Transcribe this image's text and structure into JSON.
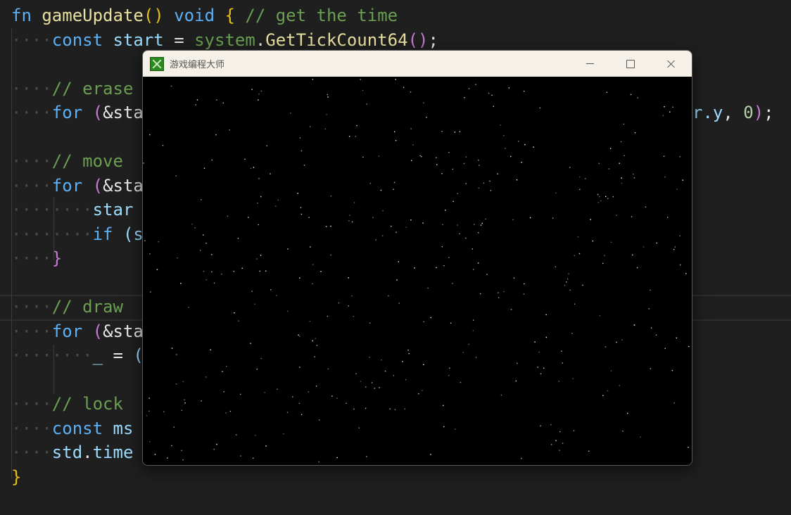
{
  "editor": {
    "colors": {
      "background": "#1f1f1f",
      "keyword": "#5cb0f5",
      "function": "#e8e0a0",
      "comment": "#6a9f52",
      "paren": "#e7c019",
      "paren2": "#c77ad6",
      "ident": "#9cdcfe",
      "number": "#b5cea8",
      "text": "#e6e6e6"
    },
    "lines": [
      {
        "indent": 0,
        "tokens": [
          {
            "t": "fn",
            "c": "keyword"
          },
          {
            "t": " "
          },
          {
            "t": "gameUpdate",
            "c": "function"
          },
          {
            "t": "()",
            "c": "paren"
          },
          {
            "t": " "
          },
          {
            "t": "void",
            "c": "keyword"
          },
          {
            "t": " "
          },
          {
            "t": "{",
            "c": "paren"
          },
          {
            "t": " "
          },
          {
            "t": "// get the time",
            "c": "comment"
          }
        ]
      },
      {
        "indent": 1,
        "tokens": [
          {
            "t": "const",
            "c": "keyword"
          },
          {
            "t": " "
          },
          {
            "t": "start",
            "c": "ident"
          },
          {
            "t": " = "
          },
          {
            "t": "system",
            "c": "comment"
          },
          {
            "t": "."
          },
          {
            "t": "GetTickCount64",
            "c": "function"
          },
          {
            "t": "()",
            "c": "paren2"
          },
          {
            "t": ";"
          }
        ]
      },
      {
        "indent": 0,
        "tokens": []
      },
      {
        "indent": 1,
        "tokens": [
          {
            "t": "// erase",
            "c": "comment"
          }
        ]
      },
      {
        "indent": 1,
        "tokens": [
          {
            "t": "for",
            "c": "keyword"
          },
          {
            "t": " "
          },
          {
            "t": "(",
            "c": "paren2"
          },
          {
            "t": "&sta"
          }
        ]
      },
      {
        "indent": 0,
        "tokens": []
      },
      {
        "indent": 1,
        "tokens": [
          {
            "t": "// move",
            "c": "comment"
          }
        ]
      },
      {
        "indent": 1,
        "tokens": [
          {
            "t": "for",
            "c": "keyword"
          },
          {
            "t": " "
          },
          {
            "t": "(",
            "c": "paren2"
          },
          {
            "t": "&sta"
          }
        ]
      },
      {
        "indent": 2,
        "tokens": [
          {
            "t": "star",
            "c": "ident"
          }
        ]
      },
      {
        "indent": 2,
        "tokens": [
          {
            "t": "if",
            "c": "keyword"
          },
          {
            "t": " "
          },
          {
            "t": "(s",
            "c": "ident"
          }
        ]
      },
      {
        "indent": 1,
        "tokens": [
          {
            "t": "}",
            "c": "paren2"
          }
        ]
      },
      {
        "indent": 0,
        "tokens": []
      },
      {
        "indent": 1,
        "tokens": [
          {
            "t": "// draw",
            "c": "comment"
          }
        ]
      },
      {
        "indent": 1,
        "tokens": [
          {
            "t": "for",
            "c": "keyword"
          },
          {
            "t": " "
          },
          {
            "t": "(",
            "c": "paren2"
          },
          {
            "t": "&sta"
          }
        ]
      },
      {
        "indent": 2,
        "tokens": [
          {
            "t": "_",
            "c": "ident"
          },
          {
            "t": " = "
          },
          {
            "t": "(",
            "c": "ident"
          }
        ]
      },
      {
        "indent": 0,
        "tokens": []
      },
      {
        "indent": 1,
        "tokens": [
          {
            "t": "// lock",
            "c": "comment"
          }
        ]
      },
      {
        "indent": 1,
        "tokens": [
          {
            "t": "const",
            "c": "keyword"
          },
          {
            "t": " "
          },
          {
            "t": "ms",
            "c": "ident"
          }
        ]
      },
      {
        "indent": 1,
        "tokens": [
          {
            "t": "std",
            "c": "ident"
          },
          {
            "t": "."
          },
          {
            "t": "time",
            "c": "ident"
          }
        ]
      },
      {
        "indent": 0,
        "tokens": [
          {
            "t": "}",
            "c": "paren"
          }
        ]
      }
    ],
    "right_fragment": [
      {
        "t": "r.",
        "c": "ident"
      },
      {
        "t": "y",
        "c": "ident"
      },
      {
        "t": ", "
      },
      {
        "t": "0",
        "c": "number"
      },
      {
        "t": ")",
        "c": "paren2"
      },
      {
        "t": ";"
      }
    ]
  },
  "window": {
    "title": "游戏编程大师",
    "app_icon": "green-x-app-icon",
    "controls": [
      "minimize-icon",
      "maximize-icon",
      "close-icon"
    ],
    "canvas_background": "#000000",
    "star_color": "#ffffff"
  }
}
